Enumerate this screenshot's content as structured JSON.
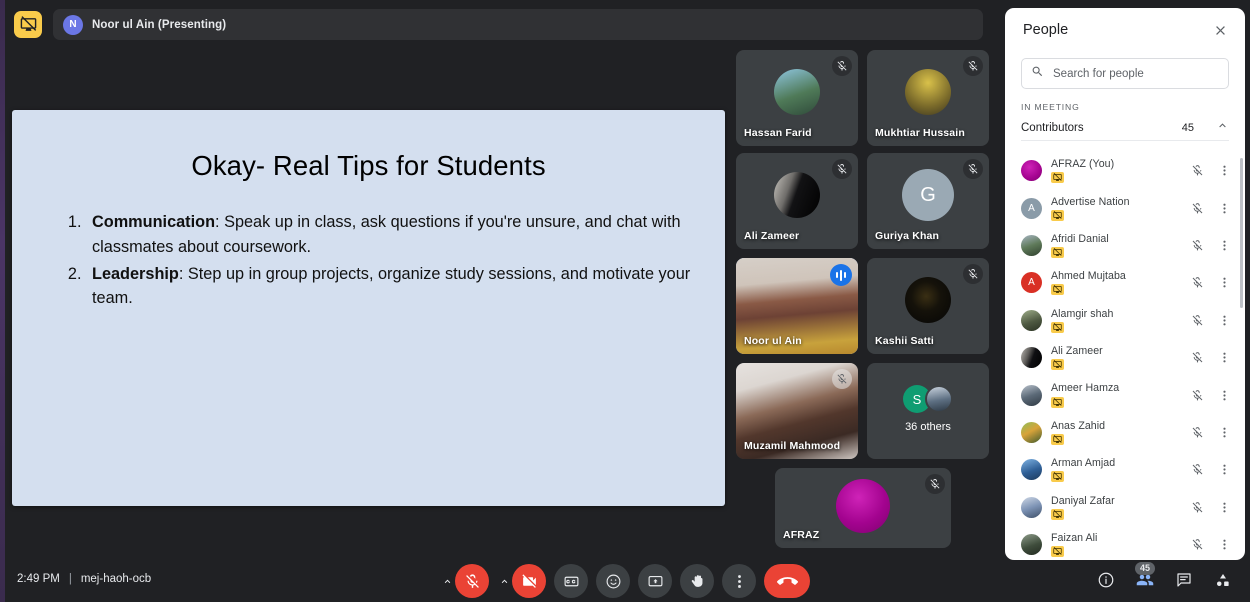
{
  "topbar": {
    "present_badge_icon": "screen-share-blocked-icon",
    "presenter_initial": "N",
    "presenter_text": "Noor ul Ain (Presenting)"
  },
  "slide": {
    "title": "Okay- Real Tips for Students",
    "bullets": [
      {
        "lead": "Communication",
        "rest": ": Speak up in class, ask questions if you're unsure, and chat with classmates about coursework."
      },
      {
        "lead": "Leadership",
        "rest": ": Step up in group projects, organize study sessions, and motivate your team."
      }
    ],
    "background_color": "#d4dfef"
  },
  "tiles": [
    {
      "name": "Hassan Farid",
      "muted": true,
      "speaking": false,
      "kind": "photo",
      "avatar_color": "#6fa8c8"
    },
    {
      "name": "Mukhtiar Hussain",
      "muted": true,
      "speaking": false,
      "kind": "photo",
      "avatar_color": "#c9a227"
    },
    {
      "name": "Ali Zameer",
      "muted": true,
      "speaking": false,
      "kind": "photo",
      "avatar_color": "#2b2b2f"
    },
    {
      "name": "Guriya Khan",
      "muted": true,
      "speaking": false,
      "kind": "letter",
      "initial": "G",
      "avatar_color": "#9aa9b4"
    },
    {
      "name": "Noor ul Ain",
      "muted": false,
      "speaking": true,
      "kind": "video",
      "avatar_color": "#b68a6e"
    },
    {
      "name": "Kashii Satti",
      "muted": true,
      "speaking": false,
      "kind": "photo",
      "avatar_color": "#111114"
    },
    {
      "name": "Muzamil Mahmood",
      "muted": true,
      "speaking": false,
      "kind": "video",
      "avatar_color": "#cbb7ae"
    },
    {
      "name": "AFRAZ",
      "muted": true,
      "speaking": false,
      "kind": "letter",
      "initial": "",
      "avatar_color": "#a3038f"
    }
  ],
  "others_tile": {
    "label": "36 others",
    "avatar_initial": "S",
    "avatar_color": "#0f9d72",
    "second_avatar_color": "#8a98a8"
  },
  "panel": {
    "title": "People",
    "close_icon": "close-icon",
    "search": {
      "icon": "search-icon",
      "placeholder": "Search for people",
      "value": ""
    },
    "section_label": "IN MEETING",
    "group": {
      "label": "Contributors",
      "count": "45",
      "chevron_icon": "chevron-up-icon"
    },
    "people": [
      {
        "name": "AFRAZ (You)",
        "avatar_color": "#a3038f",
        "initial": "",
        "muted": true,
        "presenting_blocked": true
      },
      {
        "name": "Advertise Nation",
        "avatar_color": "#8a9ba8",
        "initial": "A",
        "muted": true,
        "presenting_blocked": true
      },
      {
        "name": "Afridi Danial",
        "avatar_color": "#7d8a7a",
        "initial": "",
        "muted": true,
        "presenting_blocked": true
      },
      {
        "name": "Ahmed Mujtaba",
        "avatar_color": "#d93025",
        "initial": "A",
        "muted": true,
        "presenting_blocked": true
      },
      {
        "name": "Alamgir shah",
        "avatar_color": "#5d6b52",
        "initial": "",
        "muted": true,
        "presenting_blocked": true
      },
      {
        "name": "Ali Zameer",
        "avatar_color": "#2b2b2f",
        "initial": "",
        "muted": true,
        "presenting_blocked": true
      },
      {
        "name": "Ameer Hamza",
        "avatar_color": "#6b6f78",
        "initial": "",
        "muted": true,
        "presenting_blocked": true
      },
      {
        "name": "Anas Zahid",
        "avatar_color": "#6e8a4a",
        "initial": "",
        "muted": true,
        "presenting_blocked": true
      },
      {
        "name": "Arman Amjad",
        "avatar_color": "#5b8fc9",
        "initial": "",
        "muted": true,
        "presenting_blocked": true
      },
      {
        "name": "Daniyal Zafar",
        "avatar_color": "#8fa4c0",
        "initial": "",
        "muted": true,
        "presenting_blocked": true
      },
      {
        "name": "Faizan Ali",
        "avatar_color": "#4a5a46",
        "initial": "",
        "muted": true,
        "presenting_blocked": true
      }
    ]
  },
  "bottombar": {
    "time": "2:49 PM",
    "separator": "|",
    "meeting_code": "mej-haoh-ocb",
    "controls": [
      {
        "name": "mic-options-chevron",
        "icon": "chevron-up-icon",
        "state": "normal"
      },
      {
        "name": "microphone-button",
        "icon": "mic-off-icon",
        "state": "active-red"
      },
      {
        "name": "camera-options-chevron",
        "icon": "chevron-up-icon",
        "state": "normal"
      },
      {
        "name": "camera-button",
        "icon": "camera-off-icon",
        "state": "active-red"
      },
      {
        "name": "captions-button",
        "icon": "closed-captions-icon",
        "state": "normal"
      },
      {
        "name": "emoji-button",
        "icon": "emoji-icon",
        "state": "normal"
      },
      {
        "name": "present-button",
        "icon": "present-screen-icon",
        "state": "normal"
      },
      {
        "name": "raise-hand-button",
        "icon": "raise-hand-icon",
        "state": "normal"
      },
      {
        "name": "more-options-button",
        "icon": "more-vertical-icon",
        "state": "normal"
      },
      {
        "name": "leave-call-button",
        "icon": "end-call-icon",
        "state": "end-red"
      }
    ],
    "right_controls": [
      {
        "name": "meeting-details-button",
        "icon": "info-icon",
        "badge": ""
      },
      {
        "name": "people-panel-button",
        "icon": "people-icon",
        "badge": "45",
        "active": true
      },
      {
        "name": "chat-panel-button",
        "icon": "chat-icon",
        "badge": ""
      },
      {
        "name": "activities-button",
        "icon": "activities-icon",
        "badge": ""
      }
    ]
  }
}
